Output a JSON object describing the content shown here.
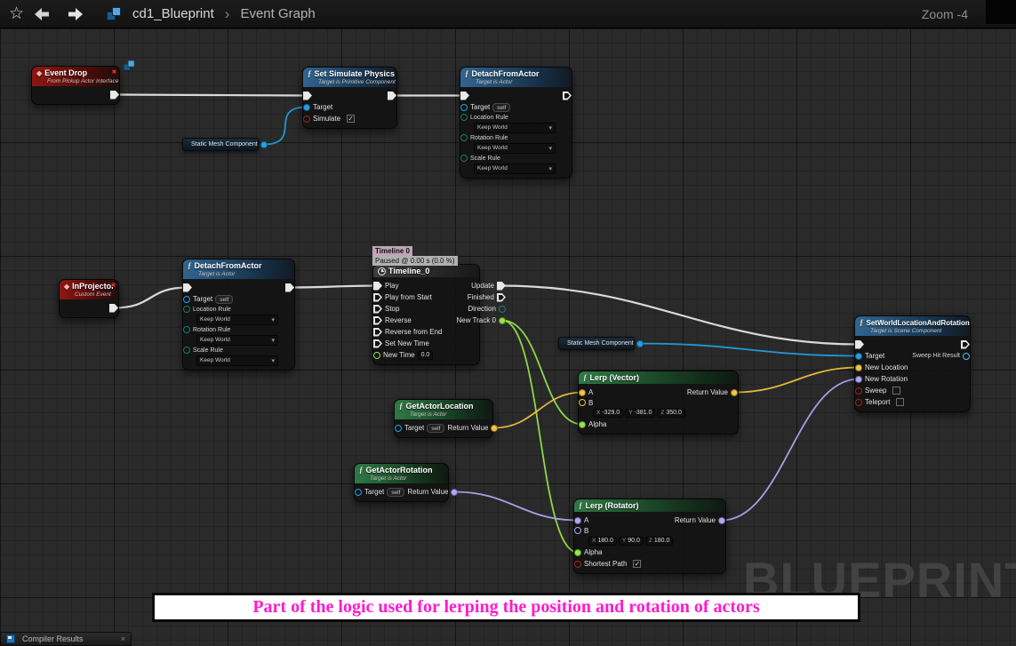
{
  "toolbar": {
    "star_icon": "☆",
    "breadcrumb_root": "cd1_Blueprint",
    "separator": "›",
    "breadcrumb_current": "Event Graph",
    "zoom_label": "Zoom -4"
  },
  "banner": {
    "text": "Part of the logic used for lerping the position and rotation of actors"
  },
  "watermark": "BLUEPRINT",
  "statusbar": {
    "compiler_results": "Compiler Results",
    "close": "×"
  },
  "colors": {
    "exec": "#e8e8e8",
    "object": "#21a2e6",
    "float": "#97e54a",
    "vector": "#f3c53f",
    "rotator": "#b3a8f8",
    "bool": "#a52222",
    "enum": "#1b7a6e",
    "struct": "#45c4ea",
    "banner_text": "#ff1ad1"
  },
  "nodes": {
    "event_drop": {
      "title": "Event Drop",
      "subtitle": "From Pickup Actor Interface"
    },
    "set_simulate_physics": {
      "title": "Set Simulate Physics",
      "subtitle": "Target is Primitive Component",
      "target": "Target",
      "simulate": "Simulate"
    },
    "detach_top": {
      "title": "DetachFromActor",
      "subtitle": "Target is Actor",
      "target": "Target",
      "self_value": "self",
      "location_rule": "Location Rule",
      "rotation_rule": "Rotation Rule",
      "scale_rule": "Scale Rule",
      "rule_value": "Keep World"
    },
    "detach_mid": {
      "title": "DetachFromActor",
      "subtitle": "Target is Actor",
      "target": "Target",
      "self_value": "self",
      "location_rule": "Location Rule",
      "rotation_rule": "Rotation Rule",
      "scale_rule": "Scale Rule",
      "rule_value": "Keep World"
    },
    "static_mesh_1": {
      "label": "Static Mesh Component"
    },
    "static_mesh_2": {
      "label": "Static Mesh Component"
    },
    "in_projector": {
      "title": "InProjector",
      "subtitle": "Custom Event"
    },
    "timeline_tooltip": {
      "line1": "Timeline 0",
      "line2": "Paused @ 0.00 s (0.0 %)"
    },
    "timeline": {
      "title": "Timeline_0",
      "play": "Play",
      "play_from_start": "Play from Start",
      "stop": "Stop",
      "reverse": "Reverse",
      "reverse_from_end": "Reverse from End",
      "set_new_time": "Set New Time",
      "new_time": "New Time",
      "new_time_value": "0.0",
      "update": "Update",
      "finished": "Finished",
      "direction": "Direction",
      "new_track": "New Track 0"
    },
    "get_actor_location": {
      "title": "GetActorLocation",
      "subtitle": "Target is Actor",
      "target": "Target",
      "self_value": "self",
      "return": "Return Value"
    },
    "get_actor_rotation": {
      "title": "GetActorRotation",
      "subtitle": "Target is Actor",
      "target": "Target",
      "self_value": "self",
      "return": "Return Value"
    },
    "lerp_vector": {
      "title": "Lerp (Vector)",
      "a": "A",
      "b": "B",
      "x_label": "X",
      "x": "-329.0",
      "y_label": "Y",
      "y": "-381.0",
      "z_label": "Z",
      "z": "350.0",
      "alpha": "Alpha",
      "return": "Return Value"
    },
    "lerp_rotator": {
      "title": "Lerp (Rotator)",
      "a": "A",
      "b": "B",
      "x_label": "X",
      "x": "180.0",
      "y_label": "Y",
      "y": "90.0",
      "z_label": "Z",
      "z": "180.0",
      "alpha": "Alpha",
      "shortest_path": "Shortest Path",
      "return": "Return Value"
    },
    "set_world": {
      "title": "SetWorldLocationAndRotation",
      "subtitle": "Target is Scene Component",
      "target": "Target",
      "new_location": "New Location",
      "new_rotation": "New Rotation",
      "sweep": "Sweep",
      "teleport": "Teleport",
      "sweep_hit_result": "Sweep Hit Result"
    }
  },
  "wires": [
    {
      "from": "event_drop.exec_out",
      "to": "ssp.exec_in",
      "color": "exec"
    },
    {
      "from": "ssp.exec_out",
      "to": "detach_top.exec_in",
      "color": "exec"
    },
    {
      "from": "static_mesh_1.out",
      "to": "ssp.target",
      "color": "object"
    },
    {
      "from": "in_projector.exec_out",
      "to": "detach_mid.exec_in",
      "color": "exec"
    },
    {
      "from": "detach_mid.exec_out",
      "to": "timeline.play",
      "color": "exec"
    },
    {
      "from": "timeline.update",
      "to": "set_world.exec_in",
      "color": "exec"
    },
    {
      "from": "timeline.new_track",
      "to": "lerp_vector.alpha",
      "color": "float"
    },
    {
      "from": "timeline.new_track",
      "to": "lerp_rotator.alpha",
      "color": "float"
    },
    {
      "from": "get_actor_location.return",
      "to": "lerp_vector.a",
      "color": "vector"
    },
    {
      "from": "lerp_vector.return",
      "to": "set_world.new_location",
      "color": "vector"
    },
    {
      "from": "get_actor_rotation.return",
      "to": "lerp_rotator.a",
      "color": "rotator"
    },
    {
      "from": "lerp_rotator.return",
      "to": "set_world.new_rotation",
      "color": "rotator"
    },
    {
      "from": "static_mesh_2.out",
      "to": "set_world.target",
      "color": "object"
    }
  ]
}
